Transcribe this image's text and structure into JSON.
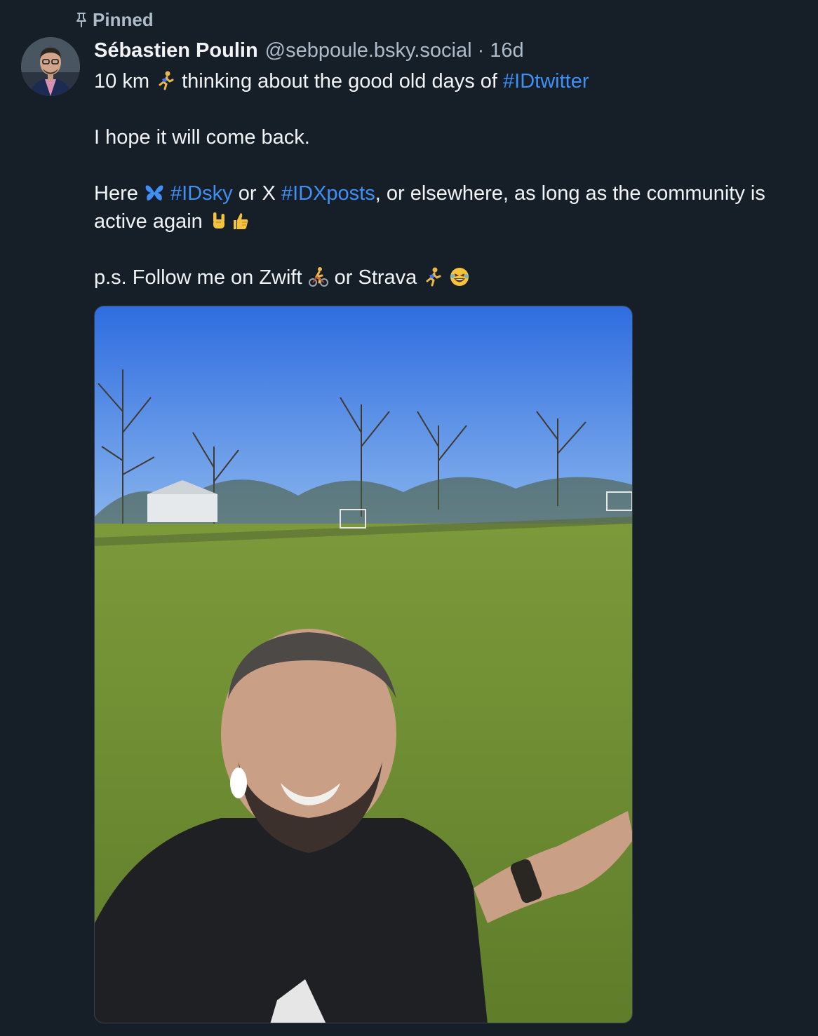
{
  "pinned": {
    "label": "Pinned",
    "icon": "pin-icon"
  },
  "author": {
    "display_name": "Sébastien Poulin",
    "handle": "@sebpoule.bsky.social",
    "separator": "·",
    "time": "16d"
  },
  "post": {
    "line1_a": "10 km",
    "line1_b": "thinking about the good old days of",
    "tag1": "#IDtwitter",
    "line2": "I hope it will come back.",
    "line3_a": "Here",
    "tag2": "#IDsky",
    "line3_b": "or X",
    "tag3": "#IDXposts",
    "line3_c": ", or elsewhere, as long as the community is active again",
    "line4_a": "p.s. Follow me on Zwift",
    "line4_b": "or Strava"
  },
  "emojis": [
    "runner",
    "butterfly",
    "rock-on-hand",
    "thumbs-up",
    "cyclist",
    "runner",
    "laughing-face"
  ],
  "colors": {
    "background": "#161e27",
    "text": "#f1f3f5",
    "muted": "#aebbc9",
    "link": "#3f8ff5"
  }
}
